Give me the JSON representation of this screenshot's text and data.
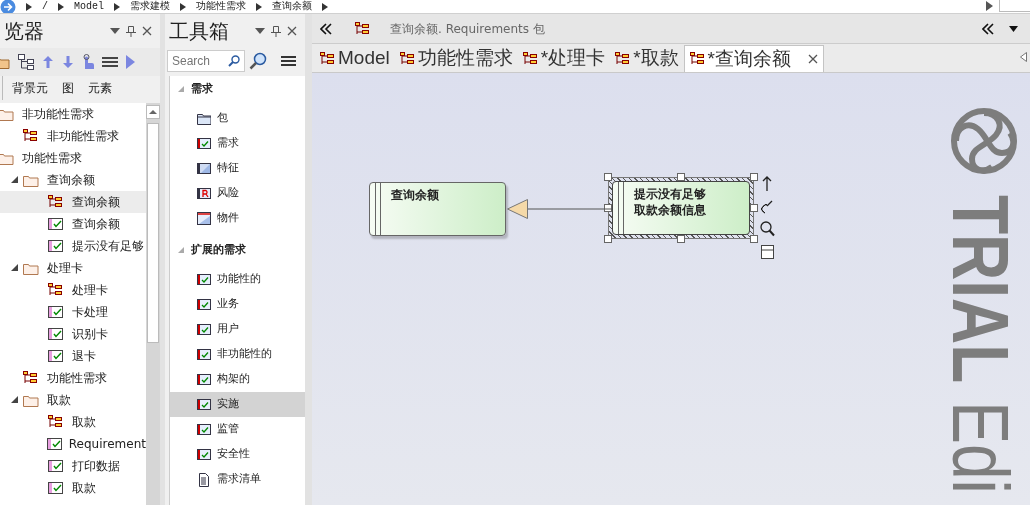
{
  "breadcrumb": [
    "/",
    "Model",
    "需求建模",
    "功能性需求",
    "查询余额"
  ],
  "browser": {
    "title": "览器",
    "tabs": [
      {
        "label": "背景元",
        "selected": false
      },
      {
        "label": "图",
        "selected": false
      },
      {
        "label": "元素",
        "selected": false
      }
    ],
    "tree": [
      {
        "kind": "folder",
        "label": "非功能性需求",
        "selected": false,
        "children": [
          {
            "kind": "diagram",
            "label": "非功能性需求",
            "selected": false
          }
        ]
      },
      {
        "kind": "folder",
        "label": "功能性需求",
        "selected": false,
        "children": [
          {
            "kind": "folder",
            "label": "查询余额",
            "selected": false,
            "expanded": true,
            "children": [
              {
                "kind": "diagram",
                "label": "查询余额",
                "selected": true
              },
              {
                "kind": "requirement",
                "label": "查询余额",
                "selected": false
              },
              {
                "kind": "requirement",
                "label": "提示没有足够",
                "selected": false
              }
            ]
          },
          {
            "kind": "folder",
            "label": "处理卡",
            "selected": false,
            "expanded": true,
            "children": [
              {
                "kind": "diagram",
                "label": "处理卡",
                "selected": false
              },
              {
                "kind": "requirement",
                "label": "卡处理",
                "selected": false
              },
              {
                "kind": "requirement",
                "label": "识别卡",
                "selected": false
              },
              {
                "kind": "requirement",
                "label": "退卡",
                "selected": false
              }
            ]
          },
          {
            "kind": "diagram",
            "label": "功能性需求",
            "selected": false
          },
          {
            "kind": "folder",
            "label": "取款",
            "selected": false,
            "expanded": true,
            "children": [
              {
                "kind": "diagram",
                "label": "取款",
                "selected": false
              },
              {
                "kind": "requirement",
                "label": "Requirement",
                "selected": false
              },
              {
                "kind": "requirement",
                "label": "打印数据",
                "selected": false
              },
              {
                "kind": "requirement",
                "label": "取款",
                "selected": false
              }
            ]
          }
        ]
      }
    ]
  },
  "toolbox": {
    "title": "工具箱",
    "search": {
      "placeholder": "Search"
    },
    "groups": [
      {
        "label": "需求",
        "expanded": true,
        "items": [
          {
            "kind": "package",
            "label": "包",
            "selected": false
          },
          {
            "kind": "requirement",
            "label": "需求",
            "selected": false
          },
          {
            "kind": "feature",
            "label": "特征",
            "selected": false
          },
          {
            "kind": "risk",
            "label": "风险",
            "selected": false
          },
          {
            "kind": "artifact",
            "label": "物件",
            "selected": false
          }
        ]
      },
      {
        "label": "扩展的需求",
        "expanded": true,
        "items": [
          {
            "kind": "requirement",
            "label": "功能性的",
            "selected": false
          },
          {
            "kind": "requirement",
            "label": "业务",
            "selected": false
          },
          {
            "kind": "requirement",
            "label": "用户",
            "selected": false
          },
          {
            "kind": "requirement",
            "label": "非功能性的",
            "selected": false
          },
          {
            "kind": "requirement",
            "label": "构架的",
            "selected": false
          },
          {
            "kind": "requirement",
            "label": "实施",
            "selected": true
          },
          {
            "kind": "requirement",
            "label": "监管",
            "selected": false
          },
          {
            "kind": "requirement",
            "label": "安全性",
            "selected": false
          },
          {
            "kind": "document",
            "label": "需求清单",
            "selected": false
          }
        ]
      }
    ]
  },
  "editor": {
    "header": "查询余额. Requirements 包",
    "tabs": [
      {
        "label": "Model",
        "selected": false
      },
      {
        "label": "功能性需求",
        "selected": false
      },
      {
        "label": "*处理卡",
        "selected": false
      },
      {
        "label": "*取款",
        "selected": false
      },
      {
        "label": "*查询余额",
        "selected": true
      }
    ],
    "diagram": {
      "nodes": [
        {
          "lines": [
            "查询余额"
          ],
          "selected": false
        },
        {
          "lines": [
            "提示没有足够",
            "取款余额信息"
          ],
          "selected": true
        }
      ]
    },
    "watermark": "**TRIAL** Edi"
  }
}
